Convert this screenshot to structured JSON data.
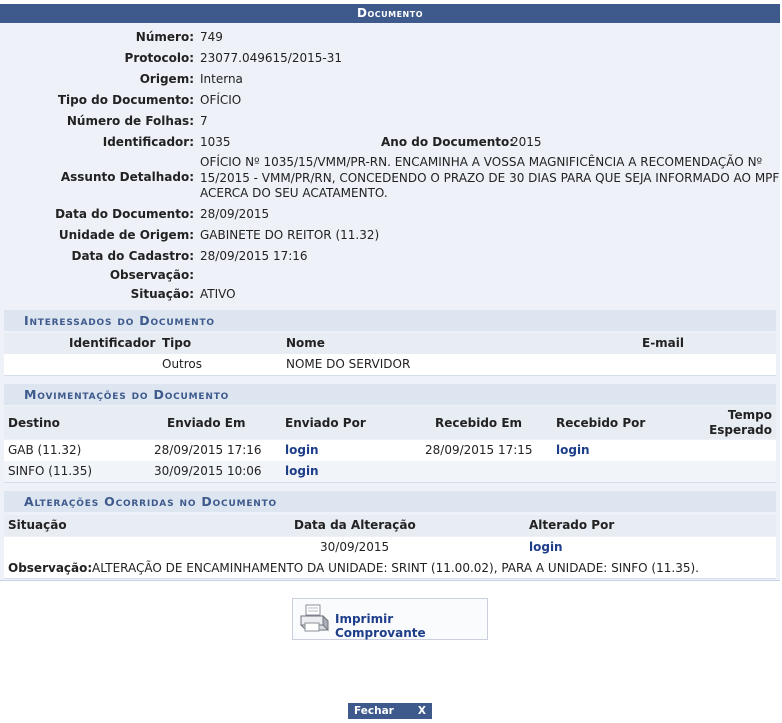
{
  "header": {
    "title": "Documento"
  },
  "document": {
    "fields": [
      {
        "label": "Número:",
        "value": "749"
      },
      {
        "label": "Protocolo:",
        "value": "23077.049615/2015-31"
      },
      {
        "label": "Origem:",
        "value": "Interna"
      },
      {
        "label": "Tipo do Documento:",
        "value": "OFÍCIO"
      },
      {
        "label": "Número de Folhas:",
        "value": "7"
      }
    ],
    "identificador_label": "Identificador:",
    "identificador_value": "1035",
    "ano_label": "Ano do Documento:",
    "ano_value": "2015",
    "assunto_label": "Assunto Detalhado:",
    "assunto_lines": [
      "OFÍCIO Nº 1035/15/VMM/PR-RN. ENCAMINHA A VOSSA MAGNIFICÊNCIA A RECOMENDAÇÃO Nº",
      "15/2015 - VMM/PR/RN, CONCEDENDO O PRAZO DE 30 DIAS PARA QUE SEJA INFORMADO AO MPF",
      "ACERCA DO SEU ACATAMENTO."
    ],
    "fields2": [
      {
        "label": "Data do Documento:",
        "value": "28/09/2015"
      },
      {
        "label": "Unidade de Origem:",
        "value": "GABINETE DO REITOR (11.32)"
      },
      {
        "label": "Data do Cadastro:",
        "value": "28/09/2015 17:16"
      },
      {
        "label": "Observação:",
        "value": ""
      },
      {
        "label": "Situação:",
        "value": "ATIVO"
      }
    ]
  },
  "interessados": {
    "title": "Interessados do Documento",
    "headers": {
      "identificador": "Identificador",
      "tipo": "Tipo",
      "nome": "Nome",
      "email": "E-mail"
    },
    "rows": [
      {
        "identificador": "",
        "tipo": "Outros",
        "nome": "NOME DO SERVIDOR",
        "email": ""
      }
    ]
  },
  "movimentacoes": {
    "title": "Movimentações do Documento",
    "headers": {
      "destino": "Destino",
      "enviado_em": "Enviado Em",
      "enviado_por": "Enviado Por",
      "recebido_em": "Recebido Em",
      "recebido_por": "Recebido Por",
      "tempo_1": "Tempo",
      "tempo_2": "Esperado"
    },
    "rows": [
      {
        "destino": "GAB (11.32)",
        "enviado_em": "28/09/2015 17:16",
        "enviado_por": "login",
        "recebido_em": "28/09/2015 17:15",
        "recebido_por": "login"
      },
      {
        "destino": "SINFO (11.35)",
        "enviado_em": "30/09/2015 10:06",
        "enviado_por": "login",
        "recebido_em": "",
        "recebido_por": ""
      }
    ]
  },
  "alteracoes": {
    "title": "Alterações Ocorridas no Documento",
    "headers": {
      "situacao": "Situação",
      "data": "Data da Alteração",
      "alterado_por": "Alterado Por"
    },
    "rows": [
      {
        "situacao": "",
        "data": "30/09/2015",
        "alterado_por": "login"
      }
    ],
    "obs_label": "Observação:",
    "obs_value": "ALTERAÇÃO DE ENCAMINHAMENTO DA UNIDADE: SRINT (11.00.02), PARA A UNIDADE: SINFO (11.35)."
  },
  "actions": {
    "print_label": "Imprimir Comprovante",
    "close_label": "Fechar",
    "close_x": "X"
  }
}
